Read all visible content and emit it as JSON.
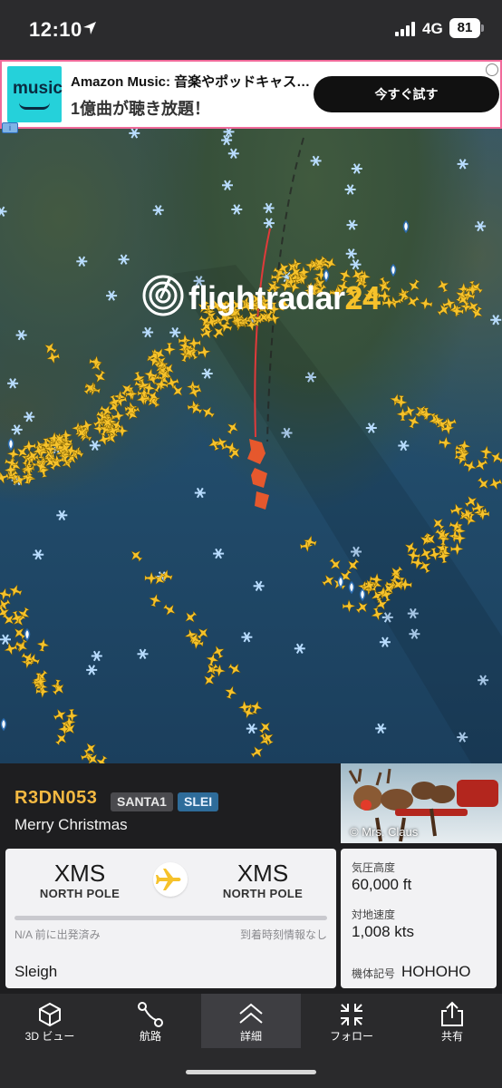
{
  "status_bar": {
    "time": "12:10",
    "network": "4G",
    "battery": "81",
    "icons": [
      "location-arrow-icon",
      "signal-icon",
      "battery-icon"
    ]
  },
  "ad": {
    "logo_text": "music",
    "title": "Amazon Music: 音楽やポッドキャス…",
    "subtitle": "1億曲が聴き放題！",
    "button": "今すぐ試す",
    "info_badge": "i"
  },
  "map": {
    "brand_main": "flightradar",
    "brand_num": "24",
    "colors": {
      "route_line": "#e03a3a",
      "aircraft": "#f6c22b",
      "selected_aircraft": "#f0582a",
      "snowflake": "#b9ddff"
    }
  },
  "flight": {
    "id": "R3DN053",
    "callsign": "SANTA1",
    "type_code": "SLEI",
    "airline": "Merry Christmas",
    "photo_credit": "© Mrs. Claus",
    "origin": {
      "code": "XMS",
      "name": "NORTH POLE"
    },
    "destination": {
      "code": "XMS",
      "name": "NORTH POLE"
    },
    "progress": 0,
    "departure_note": "N/A 前に出発済み",
    "arrival_note": "到着時刻情報なし",
    "altitude_label": "気圧高度",
    "altitude_value": "60,000 ft",
    "speed_label": "対地速度",
    "speed_value": "1,008 kts",
    "aircraft": "Sleigh",
    "registration_label": "機体記号",
    "registration": "HOHOHO"
  },
  "bottom_nav": {
    "items": [
      {
        "label": "3D ビュー",
        "icon": "cube-icon"
      },
      {
        "label": "航路",
        "icon": "route-icon"
      },
      {
        "label": "詳細",
        "icon": "chevron-up-icon",
        "active": true
      },
      {
        "label": "フォロー",
        "icon": "follow-icon"
      },
      {
        "label": "共有",
        "icon": "share-icon"
      }
    ]
  }
}
